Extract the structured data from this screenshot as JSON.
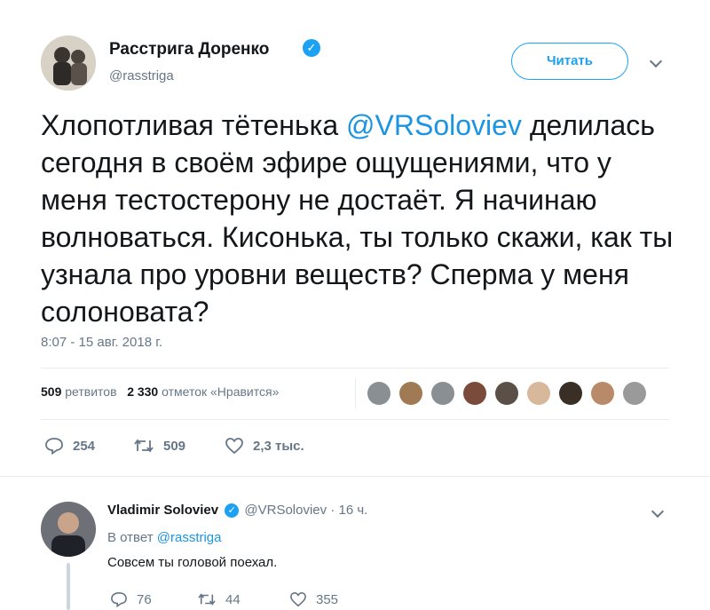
{
  "main_tweet": {
    "author_name": "Расстрига Доренко",
    "handle": "@rasstriga",
    "follow_label": "Читать",
    "text_prefix": "Хлопотливая тётенька ",
    "mention": "@VRSoloviev",
    "text_rest": "делилась сегодня в своём эфире ощущениями, что у меня тестостерону не достаёт. Я начинаю волноваться. Кисонька, ты только скажи, как ты узнала про уровни веществ? Сперма у меня солоновата?",
    "timestamp": "8:07 - 15 авг. 2018 г.",
    "retweets_count": "509",
    "retweets_label": "ретвитов",
    "likes_count": "2 330",
    "likes_label": "отметок «Нравится»",
    "actions": {
      "replies": "254",
      "retweets": "509",
      "likes": "2,3 тыс."
    },
    "likers_avatar_colors": [
      "#8a8f94",
      "#a07a55",
      "#8a8f94",
      "#7a4a3a",
      "#5a5048",
      "#d8b89a",
      "#3a2f26",
      "#b88a6a",
      "#9a9a9a"
    ]
  },
  "reply_tweet": {
    "author_name": "Vladimir Soloviev",
    "handle": "@VRSoloviev",
    "separator": "·",
    "time": "16 ч.",
    "reply_to_prefix": "В ответ",
    "reply_to_handle": "@rasstriga",
    "text": "Совсем ты головой поехал.",
    "actions": {
      "replies": "76",
      "retweets": "44",
      "likes": "355"
    }
  },
  "colors": {
    "accent": "#1da1f2",
    "link": "#1b95e0",
    "muted": "#657786",
    "divider": "#e6ecf0"
  }
}
